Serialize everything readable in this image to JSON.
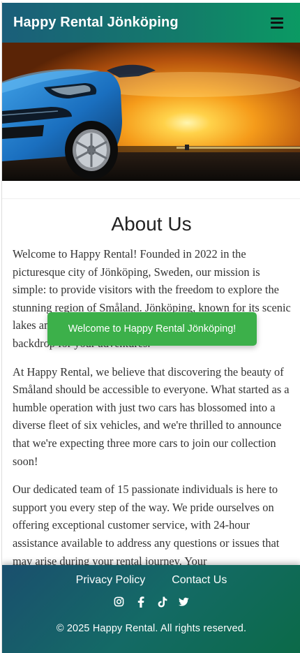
{
  "header": {
    "brand": "Happy Rental Jönköping",
    "menu_icon": "hamburger-menu-icon"
  },
  "hero": {
    "image": "blue SUV parked at sunset"
  },
  "about": {
    "title": "About Us",
    "paragraphs": [
      "Welcome to Happy Rental! Founded in 2022 in the picturesque city of Jönköping, Sweden, our mission is simple: to provide visitors with the freedom to explore the stunning region of Småland. Jönköping, known for its scenic lakes and charming surroundings, makes the perfect backdrop for your adventures.",
      "At Happy Rental, we believe that discovering the beauty of Småland should be accessible to everyone. What started as a humble operation with just two cars has blossomed into a diverse fleet of six vehicles, and we're thrilled to announce that we're expecting three more cars to join our collection soon!",
      "Our dedicated team of 15 passionate individuals is here to support you every step of the way. We pride ourselves on offering exceptional customer service, with 24-hour assistance available to address any questions or issues that may arise during your rental journey. Your"
    ]
  },
  "toast": {
    "message": "Welcome to Happy Rental Jönköping!",
    "color": "#3cb04a"
  },
  "footer": {
    "links": [
      "Privacy Policy",
      "Contact Us"
    ],
    "socials": [
      "instagram-icon",
      "facebook-icon",
      "tiktok-icon",
      "twitter-icon"
    ],
    "copyright": "© 2025 Happy Rental. All rights reserved."
  },
  "colors": {
    "header_gradient_start": "#1b5e7a",
    "header_gradient_end": "#0b9a63",
    "footer_gradient_start": "#1a4f6e",
    "footer_gradient_end": "#0b6a48"
  }
}
